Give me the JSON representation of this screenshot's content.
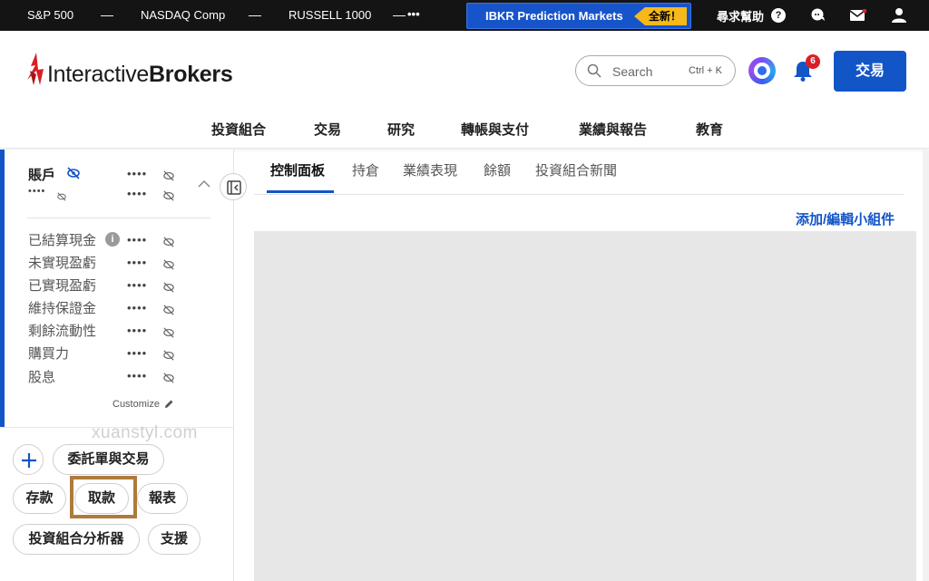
{
  "ticker": {
    "items": [
      "S&P 500",
      "NASDAQ Comp",
      "RUSSELL 1000"
    ],
    "separator": "—",
    "more": "•••"
  },
  "promo": {
    "label": "IBKR Prediction Markets",
    "badge": "全新！"
  },
  "topbar": {
    "help": "尋求幫助",
    "help_icon": "?"
  },
  "header": {
    "brand": {
      "light": "Interactive",
      "bold": "Brokers"
    },
    "search": {
      "placeholder": "Search",
      "shortcut": "Ctrl + K"
    },
    "notifications": {
      "count": "6"
    },
    "trade_button": "交易"
  },
  "main_nav": [
    "投資組合",
    "交易",
    "研究",
    "轉帳與支付",
    "業績與報告",
    "教育"
  ],
  "sidebar": {
    "account_title": "賬戶",
    "masked": "••••",
    "masked_small": "••••",
    "metrics": [
      "已結算現金",
      "未實現盈虧",
      "已實現盈虧",
      "維持保證金",
      "剩餘流動性",
      "購買力",
      "股息"
    ],
    "info_icon": "i",
    "customize": "Customize",
    "actions": {
      "add": "+",
      "orders": "委託單與交易",
      "deposit": "存款",
      "withdraw": "取款",
      "reports": "報表",
      "analyst": "投資組合分析器",
      "support": "支援"
    }
  },
  "tabs": [
    {
      "label": "控制面板",
      "active": true
    },
    {
      "label": "持倉",
      "active": false
    },
    {
      "label": "業績表現",
      "active": false
    },
    {
      "label": "餘額",
      "active": false
    },
    {
      "label": "投資組合新聞",
      "active": false
    }
  ],
  "add_widget": "添加/編輯小組件",
  "watermark": "xuanstyl.com",
  "colors": {
    "primary": "#1255c7",
    "ticker_bg": "#141414",
    "badge": "#f6b81a",
    "alert": "#d91f26",
    "highlight_box": "#b07a3c",
    "panel_bg": "#e7e7e7"
  }
}
